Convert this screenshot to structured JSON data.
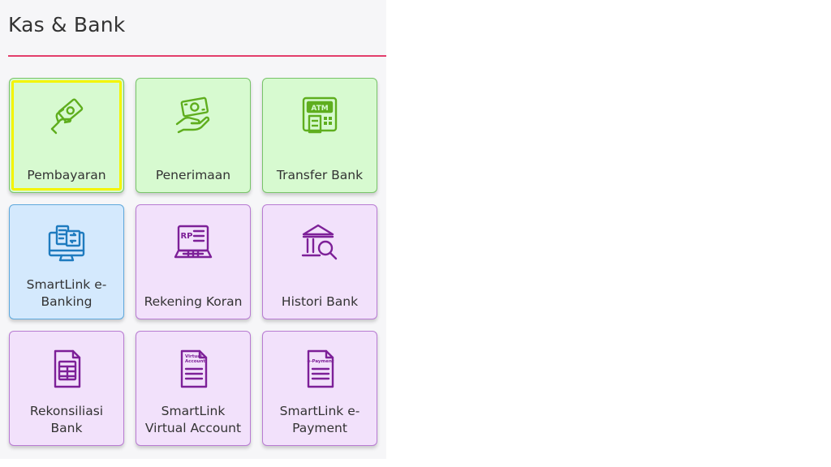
{
  "header": {
    "title": "Kas & Bank"
  },
  "colors": {
    "accent_line": "#e33e6b",
    "green_icon": "#5fae1e",
    "blue_icon": "#1e7bbf",
    "purple_icon": "#7d2098",
    "selection_outline": "#f4f400"
  },
  "tiles": [
    {
      "label": "Pembayaran",
      "icon": "hand-holding-money-icon",
      "color": "green",
      "selected": true
    },
    {
      "label": "Penerimaan",
      "icon": "receive-cash-icon",
      "color": "green",
      "selected": false
    },
    {
      "label": "Transfer Bank",
      "icon": "atm-icon",
      "color": "green",
      "selected": false
    },
    {
      "label": "SmartLink e-Banking",
      "icon": "e-banking-monitor-icon",
      "color": "blue",
      "selected": false
    },
    {
      "label": "Rekening Koran",
      "icon": "rp-statement-laptop-icon",
      "color": "purple",
      "selected": false
    },
    {
      "label": "Histori Bank",
      "icon": "bank-search-icon",
      "color": "purple",
      "selected": false
    },
    {
      "label": "Rekonsiliasi Bank",
      "icon": "reconciliation-document-icon",
      "color": "purple",
      "selected": false
    },
    {
      "label": "SmartLink Virtual Account",
      "icon": "virtual-account-document-icon",
      "color": "purple",
      "selected": false
    },
    {
      "label": "SmartLink e-Payment",
      "icon": "e-payment-document-icon",
      "color": "purple",
      "selected": false
    }
  ],
  "icon_text": {
    "atm": "ATM",
    "rp": "RP",
    "virtual_account": "Virtual Account",
    "e_payment": "e-Payment"
  }
}
